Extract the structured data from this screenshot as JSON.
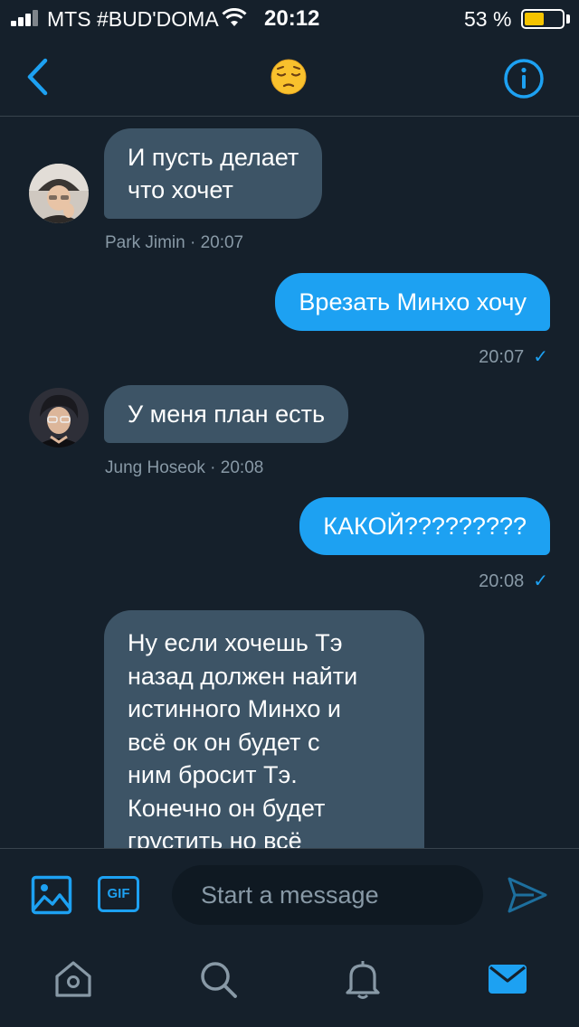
{
  "status_bar": {
    "carrier": "MTS #BUD'DOMA",
    "time": "20:12",
    "battery_percent": "53 %",
    "battery_level": 0.53
  },
  "header": {
    "title_emoji": "😔",
    "back_icon": "chevron-left-icon",
    "info_icon": "info-icon"
  },
  "messages": [
    {
      "direction": "in",
      "lines": [
        "И пусть делает",
        "что хочет"
      ],
      "sender": "Park Jimin",
      "time": "20:07",
      "meta": "Park Jimin · 20:07"
    },
    {
      "direction": "out",
      "text": "Врезать Минхо хочу",
      "time": "20:07"
    },
    {
      "direction": "in",
      "text": "У меня план есть",
      "sender": "Jung Hoseok",
      "time": "20:08",
      "meta": "Jung Hoseok · 20:08"
    },
    {
      "direction": "out",
      "text": "КАКОЙ?????????",
      "time": "20:08"
    },
    {
      "direction": "in",
      "lines": [
        "Ну если хочешь Тэ",
        "назад должен найти",
        "истинного Минхо и",
        "всё ок он будет с",
        "ним бросит Тэ.",
        "Конечно он будет",
        "грустить но всё"
      ]
    }
  ],
  "composer": {
    "placeholder": "Start a message",
    "gif_label": "GIF"
  },
  "colors": {
    "background": "#15202b",
    "accent": "#1da1f2",
    "incoming_bubble": "#3d5466",
    "secondary_text": "#8899a6",
    "battery": "#f5c400"
  }
}
